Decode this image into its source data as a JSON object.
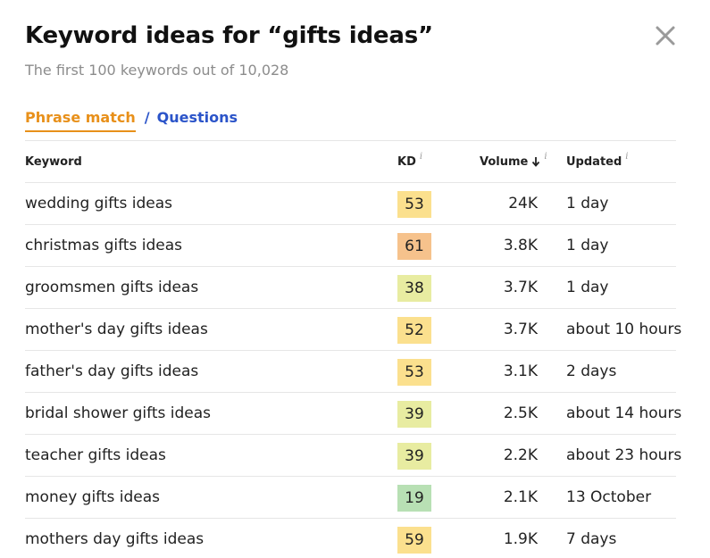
{
  "header": {
    "title": "Keyword ideas for “gifts ideas”",
    "subtitle": "The first 100 keywords out of 10,028"
  },
  "tabs": {
    "active": "Phrase match",
    "separator": "/",
    "other": "Questions"
  },
  "columns": {
    "keyword": "Keyword",
    "kd": "KD",
    "volume": "Volume",
    "volume_sort_icon": "arrow-down",
    "updated": "Updated",
    "info": "i"
  },
  "colors": {
    "accent": "#e8901a",
    "link": "#2b54c9"
  },
  "rows": [
    {
      "keyword": "wedding gifts ideas",
      "kd": "53",
      "kd_color": "#fbe08e",
      "volume": "24K",
      "updated": "1 day"
    },
    {
      "keyword": "christmas gifts ideas",
      "kd": "61",
      "kd_color": "#f6c28c",
      "volume": "3.8K",
      "updated": "1 day"
    },
    {
      "keyword": "groomsmen gifts ideas",
      "kd": "38",
      "kd_color": "#e8eca1",
      "volume": "3.7K",
      "updated": "1 day"
    },
    {
      "keyword": "mother's day gifts ideas",
      "kd": "52",
      "kd_color": "#fbe08e",
      "volume": "3.7K",
      "updated": "about 10 hours"
    },
    {
      "keyword": "father's day gifts ideas",
      "kd": "53",
      "kd_color": "#fbe08e",
      "volume": "3.1K",
      "updated": "2 days"
    },
    {
      "keyword": "bridal shower gifts ideas",
      "kd": "39",
      "kd_color": "#e8eca1",
      "volume": "2.5K",
      "updated": "about 14 hours"
    },
    {
      "keyword": "teacher gifts ideas",
      "kd": "39",
      "kd_color": "#e8eca1",
      "volume": "2.2K",
      "updated": "about 23 hours"
    },
    {
      "keyword": "money gifts ideas",
      "kd": "19",
      "kd_color": "#b8e0b4",
      "volume": "2.1K",
      "updated": "13 October"
    },
    {
      "keyword": "mothers day gifts ideas",
      "kd": "59",
      "kd_color": "#fbe08e",
      "volume": "1.9K",
      "updated": "7 days"
    }
  ]
}
